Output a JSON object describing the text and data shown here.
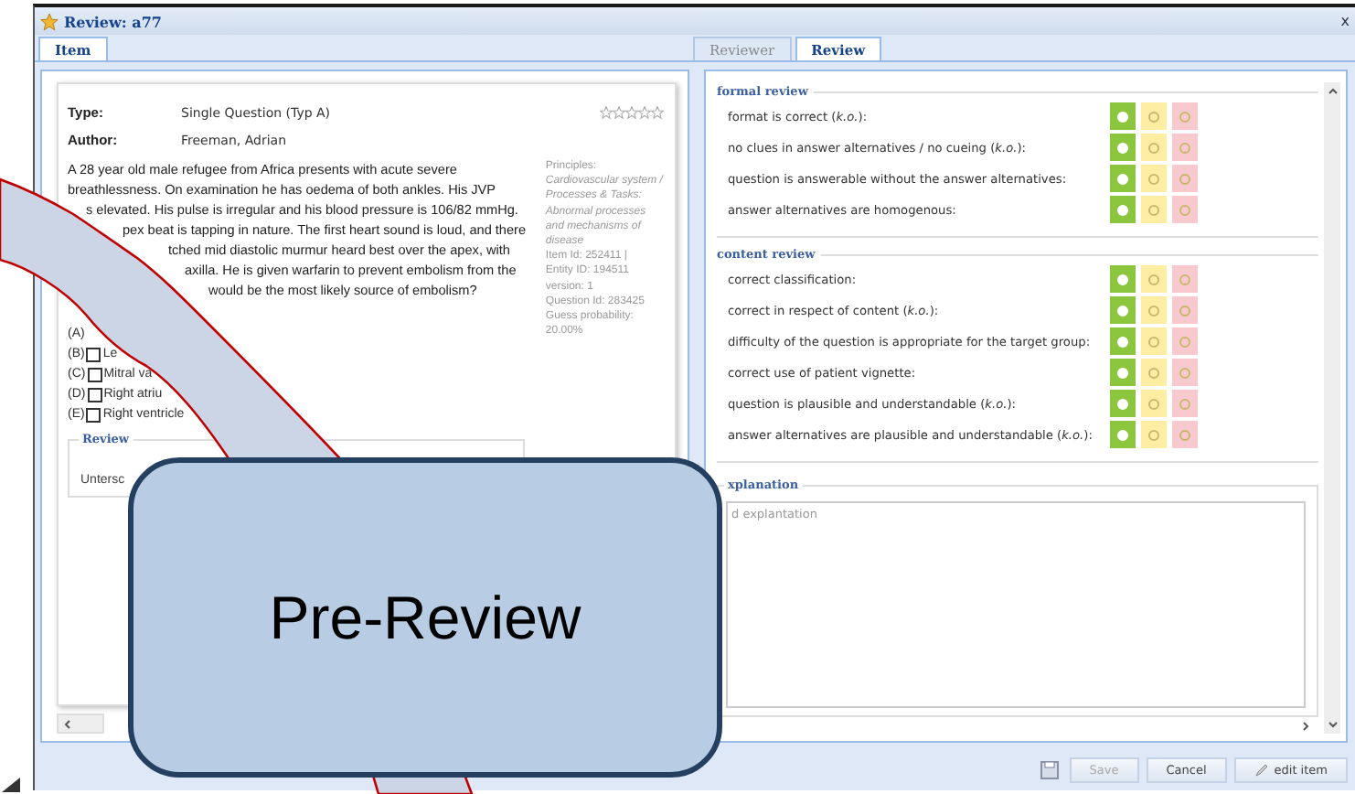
{
  "window": {
    "title": "Review: a77",
    "close": "x"
  },
  "left_tabs": [
    {
      "label": "Item",
      "selected": true
    }
  ],
  "right_tabs": [
    {
      "label": "Reviewer",
      "selected": false
    },
    {
      "label": "Review",
      "selected": true
    }
  ],
  "item": {
    "type_label": "Type:",
    "type_value": "Single Question (Typ A)",
    "author_label": "Author:",
    "author_value": "Freeman, Adrian",
    "stars": 0,
    "vignette": [
      "A 28 year old male refugee from Africa presents with acute severe",
      "breathlessness. On examination he has oedema of both ankles. His JVP",
      "s elevated. His pulse is irregular and his blood pressure is 106/82 mmHg.",
      "pex beat is tapping in nature. The first heart sound is loud, and there",
      "tched mid diastolic murmur heard best over the apex, with",
      "axilla. He is given warfarin to prevent embolism from the",
      "would be the most likely source of embolism?"
    ],
    "meta": [
      {
        "kind": "plain",
        "text": "Principles:"
      },
      {
        "kind": "italic",
        "text": "Cardiovascular system / Processes & Tasks:"
      },
      {
        "kind": "italic",
        "text": "Abnormal processes and mechanisms of disease"
      },
      {
        "kind": "plain",
        "text": "Item Id: 252411 |"
      },
      {
        "kind": "plain",
        "text": "Entity ID: 194511"
      },
      {
        "kind": "plain",
        "text": "version: 1"
      },
      {
        "kind": "plain",
        "text": "Question Id: 283425"
      },
      {
        "kind": "plain",
        "text": "Guess probability: 20.00%"
      }
    ],
    "options": [
      {
        "letter": "(A)"
      },
      {
        "letter": "(B)",
        "checked": false,
        "text": "Le"
      },
      {
        "letter": "(C)",
        "checked": false,
        "text": "Mitral va"
      },
      {
        "letter": "(D)",
        "checked": false,
        "text": "Right atriu"
      },
      {
        "letter": "(E)",
        "checked": false,
        "text": "Right ventricle"
      }
    ],
    "review": {
      "legend": "Review",
      "text": "Untersc"
    }
  },
  "review_groups": [
    {
      "legend": "formal review",
      "rows": [
        {
          "label": "format is correct (*k.o.*):",
          "options": [
            {
              "color": "#8cc63f",
              "selected": true
            },
            {
              "color": "#fdeea3",
              "selected": false
            },
            {
              "color": "#f9c9d0",
              "selected": false
            }
          ]
        },
        {
          "label": "no clues in answer alternatives / no cueing (*k.o.*):",
          "options": [
            {
              "color": "#8cc63f",
              "selected": true
            },
            {
              "color": "#fdeea3",
              "selected": false
            },
            {
              "color": "#f9c9d0",
              "selected": false
            }
          ]
        },
        {
          "label": "question is answerable without the answer alternatives:",
          "options": [
            {
              "color": "#8cc63f",
              "selected": true
            },
            {
              "color": "#fdeea3",
              "selected": false
            },
            {
              "color": "#f9c9d0",
              "selected": false
            }
          ]
        },
        {
          "label": "answer alternatives are homogenous:",
          "options": [
            {
              "color": "#8cc63f",
              "selected": true
            },
            {
              "color": "#fdeea3",
              "selected": false
            },
            {
              "color": "#f9c9d0",
              "selected": false
            }
          ]
        }
      ]
    },
    {
      "legend": "content review",
      "rows": [
        {
          "label": "correct classification:",
          "options": [
            {
              "color": "#8cc63f",
              "selected": true
            },
            {
              "color": "#fdeea3",
              "selected": false
            },
            {
              "color": "#f9c9d0",
              "selected": false
            }
          ]
        },
        {
          "label": "correct in respect of content (*k.o.*):",
          "options": [
            {
              "color": "#8cc63f",
              "selected": true
            },
            {
              "color": "#fdeea3",
              "selected": false
            },
            {
              "color": "#f9c9d0",
              "selected": false
            }
          ]
        },
        {
          "label": "difficulty of the question is appropriate for the target group:",
          "options": [
            {
              "color": "#8cc63f",
              "selected": true
            },
            {
              "color": "#fdeea3",
              "selected": false
            },
            {
              "color": "#f9c9d0",
              "selected": false
            }
          ]
        },
        {
          "label": "correct use of patient vignette:",
          "options": [
            {
              "color": "#8cc63f",
              "selected": true
            },
            {
              "color": "#fdeea3",
              "selected": false
            },
            {
              "color": "#f9c9d0",
              "selected": false
            }
          ]
        },
        {
          "label": "question is plausible and understandable (*k.o.*):",
          "options": [
            {
              "color": "#8cc63f",
              "selected": true
            },
            {
              "color": "#fdeea3",
              "selected": false
            },
            {
              "color": "#f9c9d0",
              "selected": false
            }
          ]
        },
        {
          "label": "answer alternatives are plausible and understandable (*k.o.*):",
          "options": [
            {
              "color": "#8cc63f",
              "selected": true
            },
            {
              "color": "#fdeea3",
              "selected": false
            },
            {
              "color": "#f9c9d0",
              "selected": false
            }
          ]
        }
      ]
    }
  ],
  "explanation": {
    "legend": "xplanation",
    "placeholder": "d explantation"
  },
  "buttons": [
    {
      "kind": "save",
      "label": "Save",
      "disabled": true
    },
    {
      "kind": "cancel",
      "label": "Cancel",
      "disabled": false
    },
    {
      "kind": "edit",
      "label": "edit item",
      "disabled": false
    }
  ],
  "callout": {
    "text": "Pre-Review"
  }
}
